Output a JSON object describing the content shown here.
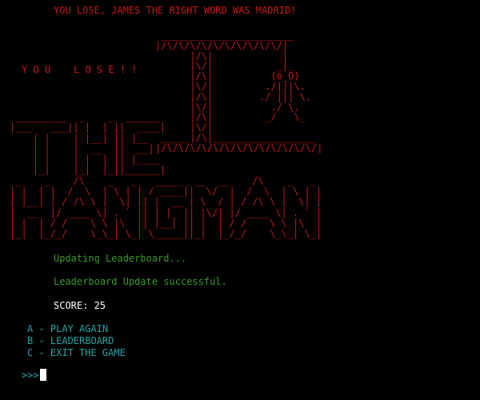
{
  "lose_message": "YOU LOSE, JAMES THE RIGHT WORD WAS MADRID!",
  "you_lose_banner": "Y O U    L O S E ! !",
  "gallows_art": " _______________________\n|/\\/\\/\\/\\/\\/\\/\\/\\/\\/\\/|\n      |/\\|            |\n      |\\/|           _|_\n      |/\\|          (o_O)\n      |\\/|         ./|||\\.\n      |/\\|        ./ ||| \\.\n      |\\/|          ./ \\.\n      |/\\|         _/   \\_\n      |\\/|\n _____|/\\|__________________\n|/\\/\\/\\/\\/\\/\\/\\/\\/\\/\\/\\/\\/\\/|",
  "title_art": " _________  _    _  ______\n|___   ___|| |  | ||  ____|\n    | |    | |__| || |__\n    | |    |  __  ||  __|\n    | |    | |  | || |____\n    |_|    |_|  |_||______|\n _    _    /\\    _   _   _____  __  __    /\\    _   _\n| |  | |  /  \\  | \\ | | / ____||  \\/  |  /  \\  | \\ | |\n| |__| | / /\\ \\ |  \\| || |  __ | \\  / | / /\\ \\ |  \\| |\n|  __  |/ ____ \\| . ` || | |_ || |\\/| |/ ____ \\| . ` |\n| |  | / /    \\ \\ |\\  || |__| || |  | / /    \\ \\ |\\  |\n|_|  |_/_/    \\_\\_| \\_| \\_____||_|  |_/_/    \\_\\_| \\_|",
  "status": {
    "updating": "Updating Leaderboard...",
    "update_success": "Leaderboard Update successful."
  },
  "score_text": "SCORE: 25",
  "menu": {
    "option_a": "A - PLAY AGAIN",
    "option_b": "B - LEADERBOARD",
    "option_c": "C - EXIT THE GAME"
  },
  "prompt": ">>>",
  "colors": {
    "background": "#000000",
    "error_red": "#c41a1a",
    "success_green": "#3a9a2a",
    "menu_cyan": "#1fa6a6",
    "score_white": "#ffffff"
  }
}
